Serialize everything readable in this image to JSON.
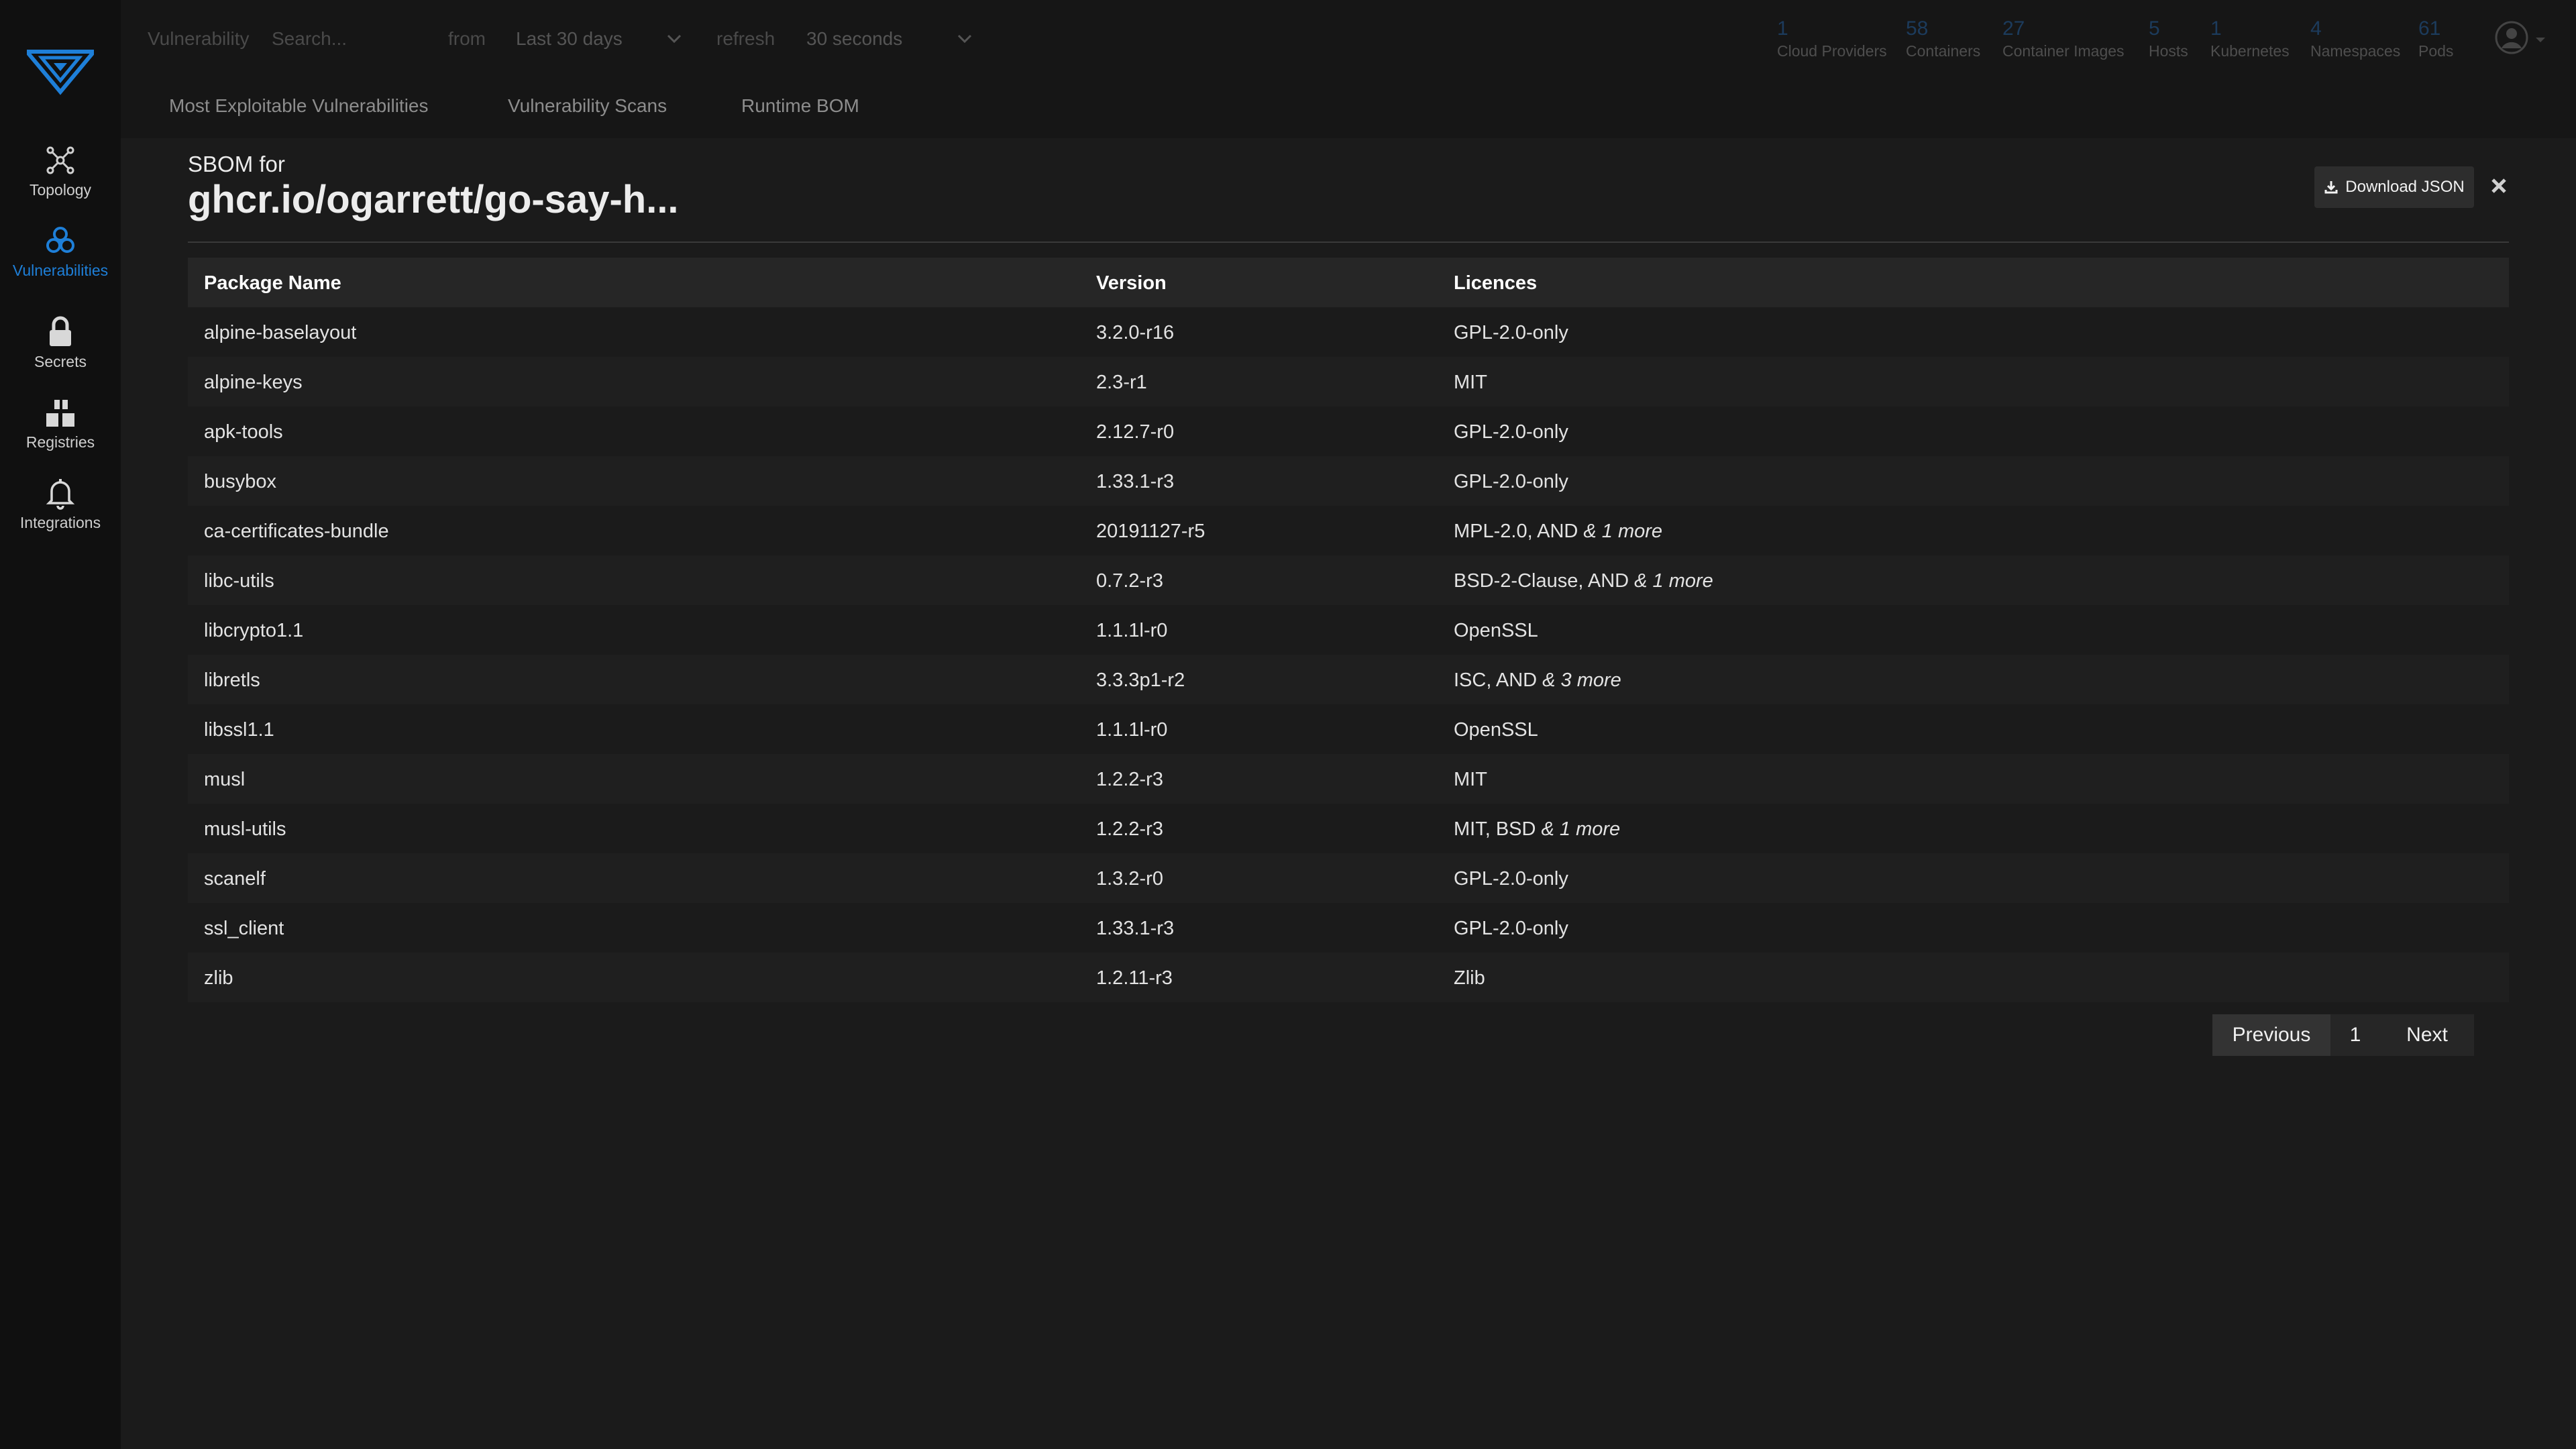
{
  "sidebar": {
    "items": [
      {
        "label": "Topology",
        "icon": "topology-icon"
      },
      {
        "label": "Vulnerabilities",
        "icon": "biohazard-icon",
        "active": true
      },
      {
        "label": "Secrets",
        "icon": "lock-icon"
      },
      {
        "label": "Registries",
        "icon": "registries-icon"
      },
      {
        "label": "Integrations",
        "icon": "bell-icon"
      }
    ]
  },
  "topbar": {
    "filter_label": "Vulnerability",
    "search_placeholder": "Search...",
    "from_label": "from",
    "from_value": "Last 30 days",
    "refresh_label": "refresh",
    "refresh_value": "30 seconds",
    "stats": [
      {
        "num": "1",
        "label": "Cloud Providers"
      },
      {
        "num": "58",
        "label": "Containers"
      },
      {
        "num": "27",
        "label": "Container Images"
      },
      {
        "num": "5",
        "label": "Hosts"
      },
      {
        "num": "1",
        "label": "Kubernetes"
      },
      {
        "num": "4",
        "label": "Namespaces"
      },
      {
        "num": "61",
        "label": "Pods"
      }
    ]
  },
  "tabs": [
    "Most Exploitable Vulnerabilities",
    "Vulnerability Scans",
    "Runtime BOM"
  ],
  "panel": {
    "small_title": "SBOM for",
    "title": "ghcr.io/ogarrett/go-say-h...",
    "download_label": "Download JSON"
  },
  "table": {
    "headers": [
      "Package Name",
      "Version",
      "Licences"
    ],
    "rows": [
      {
        "name": "alpine-baselayout",
        "version": "3.2.0-r16",
        "licence": "GPL-2.0-only",
        "more": ""
      },
      {
        "name": "alpine-keys",
        "version": "2.3-r1",
        "licence": "MIT",
        "more": ""
      },
      {
        "name": "apk-tools",
        "version": "2.12.7-r0",
        "licence": "GPL-2.0-only",
        "more": ""
      },
      {
        "name": "busybox",
        "version": "1.33.1-r3",
        "licence": "GPL-2.0-only",
        "more": ""
      },
      {
        "name": "ca-certificates-bundle",
        "version": "20191127-r5",
        "licence": "MPL-2.0, AND",
        "more": "& 1 more"
      },
      {
        "name": "libc-utils",
        "version": "0.7.2-r3",
        "licence": "BSD-2-Clause, AND",
        "more": "& 1 more"
      },
      {
        "name": "libcrypto1.1",
        "version": "1.1.1l-r0",
        "licence": "OpenSSL",
        "more": ""
      },
      {
        "name": "libretls",
        "version": "3.3.3p1-r2",
        "licence": "ISC, AND",
        "more": "& 3 more"
      },
      {
        "name": "libssl1.1",
        "version": "1.1.1l-r0",
        "licence": "OpenSSL",
        "more": ""
      },
      {
        "name": "musl",
        "version": "1.2.2-r3",
        "licence": "MIT",
        "more": ""
      },
      {
        "name": "musl-utils",
        "version": "1.2.2-r3",
        "licence": "MIT, BSD",
        "more": "& 1 more"
      },
      {
        "name": "scanelf",
        "version": "1.3.2-r0",
        "licence": "GPL-2.0-only",
        "more": ""
      },
      {
        "name": "ssl_client",
        "version": "1.33.1-r3",
        "licence": "GPL-2.0-only",
        "more": ""
      },
      {
        "name": "zlib",
        "version": "1.2.11-r3",
        "licence": "Zlib",
        "more": ""
      }
    ]
  },
  "pagination": {
    "prev": "Previous",
    "page": "1",
    "next": "Next"
  },
  "colors": {
    "accent": "#1e7fd8",
    "background": "#1b1b1b",
    "sidebar": "#101010"
  }
}
